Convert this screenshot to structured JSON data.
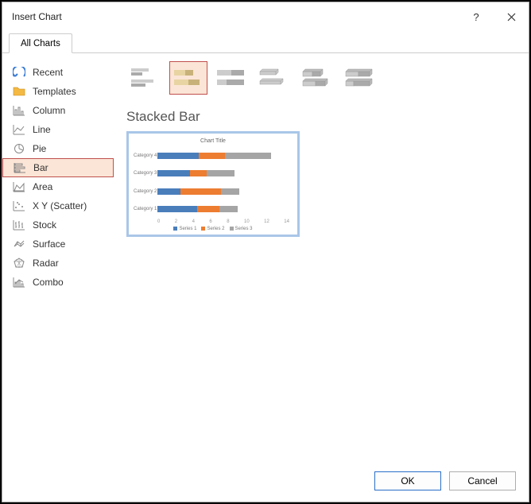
{
  "title": "Insert Chart",
  "tab_label": "All Charts",
  "sidebar": {
    "items": [
      {
        "label": "Recent",
        "name": "recent"
      },
      {
        "label": "Templates",
        "name": "templates"
      },
      {
        "label": "Column",
        "name": "column"
      },
      {
        "label": "Line",
        "name": "line"
      },
      {
        "label": "Pie",
        "name": "pie"
      },
      {
        "label": "Bar",
        "name": "bar",
        "selected": true
      },
      {
        "label": "Area",
        "name": "area"
      },
      {
        "label": "X Y (Scatter)",
        "name": "scatter"
      },
      {
        "label": "Stock",
        "name": "stock"
      },
      {
        "label": "Surface",
        "name": "surface"
      },
      {
        "label": "Radar",
        "name": "radar"
      },
      {
        "label": "Combo",
        "name": "combo"
      }
    ]
  },
  "subtypes": [
    {
      "name": "clustered-bar"
    },
    {
      "name": "stacked-bar",
      "selected": true
    },
    {
      "name": "100-stacked-bar"
    },
    {
      "name": "3d-clustered-bar"
    },
    {
      "name": "3d-stacked-bar"
    },
    {
      "name": "3d-100-stacked-bar"
    }
  ],
  "selected_chart_name": "Stacked Bar",
  "preview": {
    "title": "Chart Title",
    "categories": [
      "Category 4",
      "Category 3",
      "Category 2",
      "Category 1"
    ],
    "series_labels": [
      "Series 1",
      "Series 2",
      "Series 3"
    ],
    "xticks": [
      "0",
      "2",
      "4",
      "6",
      "8",
      "10",
      "12",
      "14"
    ]
  },
  "buttons": {
    "ok": "OK",
    "cancel": "Cancel"
  },
  "chart_data": {
    "type": "bar",
    "title": "Chart Title",
    "xlabel": "",
    "ylabel": "",
    "xlim": [
      0,
      14
    ],
    "categories": [
      "Category 1",
      "Category 2",
      "Category 3",
      "Category 4"
    ],
    "series": [
      {
        "name": "Series 1",
        "values": [
          4.3,
          2.5,
          3.5,
          4.5
        ]
      },
      {
        "name": "Series 2",
        "values": [
          2.4,
          4.4,
          1.8,
          2.8
        ]
      },
      {
        "name": "Series 3",
        "values": [
          2.0,
          2.0,
          3.0,
          5.0
        ]
      }
    ],
    "stacked": true,
    "orientation": "horizontal"
  }
}
